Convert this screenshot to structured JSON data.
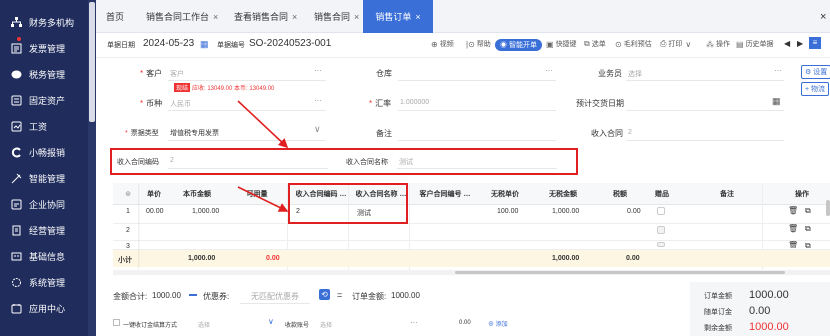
{
  "sidebar": {
    "items": [
      {
        "label": "财务多机构",
        "icon": "org-icon"
      },
      {
        "label": "发票管理",
        "icon": "invoice-icon"
      },
      {
        "label": "税务管理",
        "icon": "tax-icon"
      },
      {
        "label": "固定资产",
        "icon": "asset-icon"
      },
      {
        "label": "工资",
        "icon": "wage-icon"
      },
      {
        "label": "小畅报销",
        "icon": "reimburse-icon"
      },
      {
        "label": "智能管理",
        "icon": "smart-icon"
      },
      {
        "label": "企业协同",
        "icon": "collab-icon"
      },
      {
        "label": "经营管理",
        "icon": "business-icon"
      },
      {
        "label": "基础信息",
        "icon": "base-info-icon"
      },
      {
        "label": "系统管理",
        "icon": "system-icon"
      },
      {
        "label": "应用中心",
        "icon": "app-center-icon"
      }
    ]
  },
  "tabs": [
    {
      "label": "首页",
      "close": ""
    },
    {
      "label": "销售合同工作台",
      "close": "×"
    },
    {
      "label": "查看销售合同",
      "close": "×"
    },
    {
      "label": "销售合同",
      "close": "×"
    },
    {
      "label": "销售订单",
      "close": "×"
    }
  ],
  "window_close": "×",
  "toolbar": {
    "date_label": "单据日期",
    "date_value": "2024-05-23",
    "no_label": "单据编号",
    "no_value": "SO-20240523-001",
    "video": "视频",
    "help": "帮助",
    "smart": "智能开单",
    "shortcut": "快捷键",
    "pick": "选单",
    "margin": "毛利预估",
    "print": "打印",
    "ops": "操作",
    "history": "历史单据"
  },
  "form": {
    "customer_label": "客户",
    "customer_ph": "客户",
    "warehouse_label": "仓库",
    "salesman_label": "业务员",
    "salesman_ph": "选择",
    "settings": "设置",
    "credit_badge": "现结",
    "credit_text": "应收: 13049.00  本币: 13049.00",
    "currency_label": "币种",
    "currency_ph": "人民币",
    "rate_label": "汇率",
    "rate_value": "1.000000",
    "delivery_label": "预计交货日期",
    "more": "+ 物流",
    "invoice_type_label": "票据类型",
    "invoice_type_value": "增值税专用发票",
    "remark_label": "备注",
    "contract_label": "收入合同",
    "contract_value": "2",
    "contract_code_label": "收入合同编码",
    "contract_code_value": "2",
    "contract_name_label": "收入合同名称",
    "contract_name_value": "测试"
  },
  "grid": {
    "headers": [
      "单价",
      "本币金额",
      "可用量",
      "收入合同编码 …",
      "收入合同名称 …",
      "客户合同编号 …",
      "无税单价",
      "无税金额",
      "税额",
      "赠品",
      "备注",
      "操作"
    ],
    "rows": [
      {
        "no": "1",
        "price": "00.00",
        "amount": "1,000.00",
        "code": "2",
        "name": "测试",
        "net_price": "100.00",
        "net_amount": "1,000.00",
        "tax": "0.00"
      },
      {
        "no": "2"
      },
      {
        "no": "3"
      }
    ],
    "subtotal": {
      "label": "小计",
      "amount": "1,000.00",
      "qty": "0.00",
      "net_amount": "1,000.00",
      "tax": "0.00"
    }
  },
  "footer": {
    "total_label": "金额合计:",
    "total_value": "1000.00",
    "discount_label": "优惠券:",
    "discount_ph": "无匹配优惠券",
    "order_label": "订单金额:",
    "order_value": "1000.00",
    "order_amount_label": "订单金额",
    "order_amount_value": "1000.00",
    "deposit_label": "随单订金",
    "deposit_value": "0.00",
    "remain_label": "剩余金额",
    "remain_value": "1000.00",
    "one_key": "一键收订金",
    "settle_label": "结算方式",
    "settle_ph": "选择",
    "account_label": "收款账号",
    "account_ph": "选择",
    "amount_zero": "0.00",
    "add": "添加"
  },
  "colors": {
    "sidebar": "#1f2c5c",
    "accent": "#3a6fd8",
    "alert": "#e02020"
  }
}
